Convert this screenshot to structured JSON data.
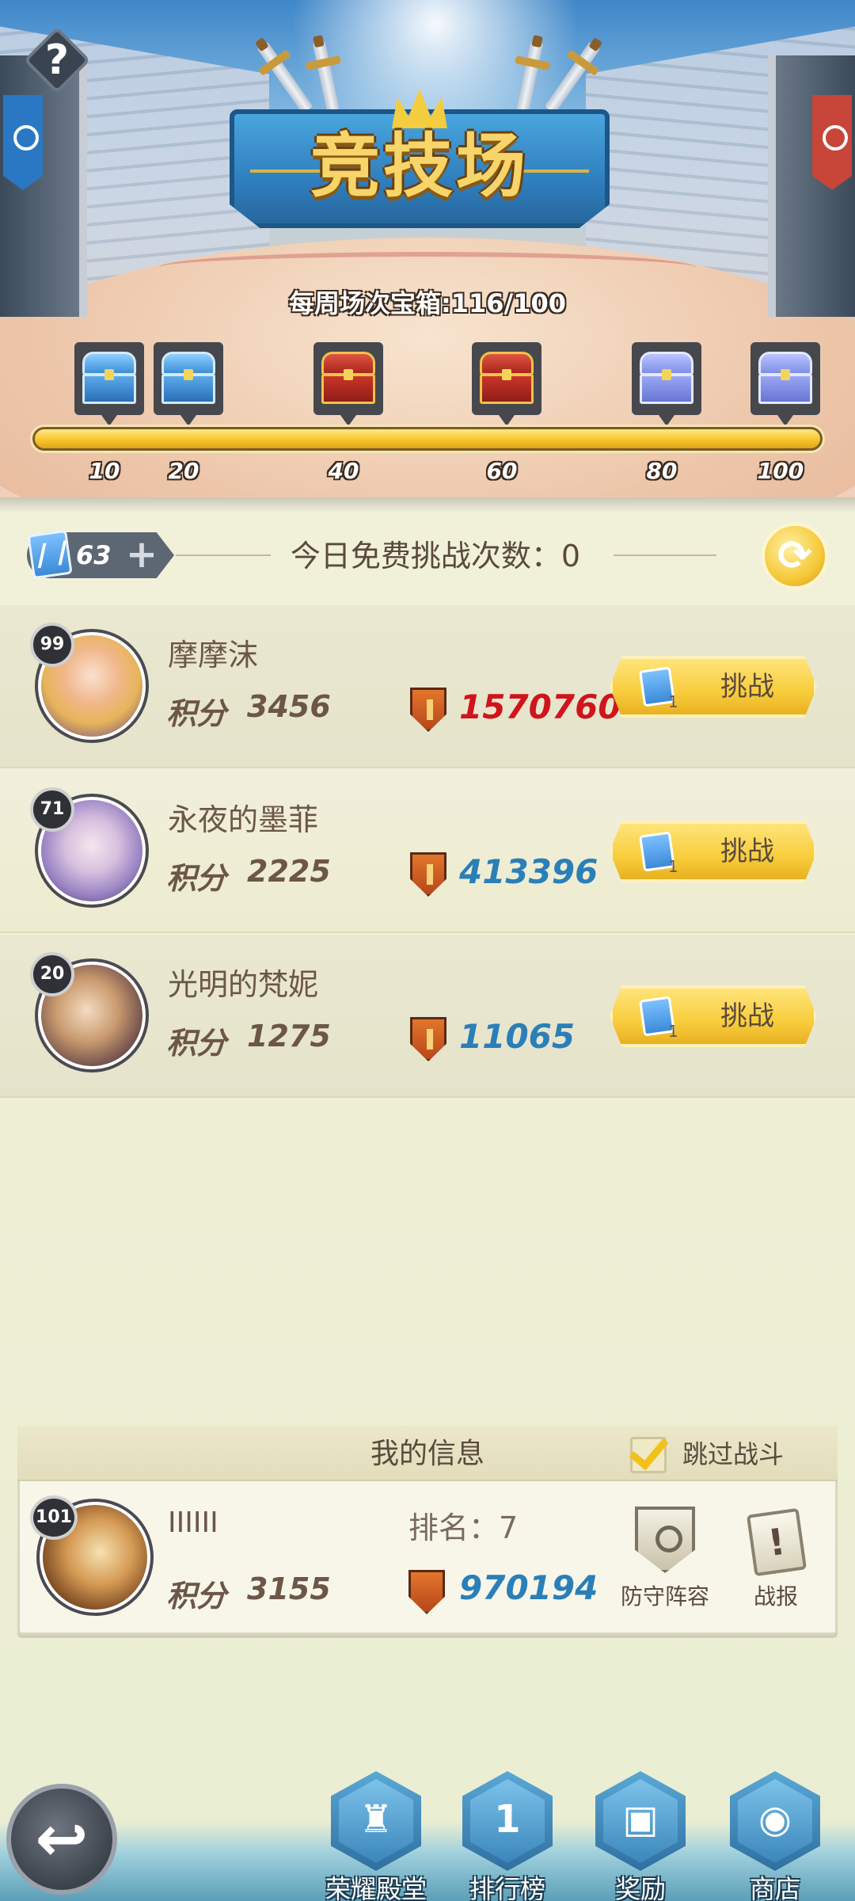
{
  "header": {
    "help_label": "?",
    "title": "竞技场",
    "weekly_chest_label": "每周场次宝箱:116/100",
    "weekly_progress_fraction": 1.0,
    "chests": [
      {
        "milestone": "10",
        "type": "blue"
      },
      {
        "milestone": "20",
        "type": "blue"
      },
      {
        "milestone": "40",
        "type": "red"
      },
      {
        "milestone": "60",
        "type": "red"
      },
      {
        "milestone": "80",
        "type": "purple"
      },
      {
        "milestone": "100",
        "type": "purple"
      }
    ]
  },
  "challenge_bar": {
    "ticket_count": "63",
    "plus_label": "+",
    "free_challenges_label": "今日免费挑战次数：0",
    "refresh_icon": "refresh-icon"
  },
  "opponents": [
    {
      "level": "99",
      "name": "摩摩沫",
      "score_label": "积分",
      "score": "3456",
      "power": "1570760",
      "power_color": "#d0141c",
      "ticket_cost": "1",
      "challenge_label": "挑战"
    },
    {
      "level": "71",
      "name": "永夜的墨菲",
      "score_label": "积分",
      "score": "2225",
      "power": "413396",
      "power_color": "#2a7fb8",
      "ticket_cost": "1",
      "challenge_label": "挑战"
    },
    {
      "level": "20",
      "name": "光明的梵妮",
      "score_label": "积分",
      "score": "1275",
      "power": "11065",
      "power_color": "#2a7fb8",
      "ticket_cost": "1",
      "challenge_label": "挑战"
    }
  ],
  "my_info": {
    "title": "我的信息",
    "skip_battle_label": "跳过战斗",
    "skip_battle_checked": true,
    "level": "101",
    "name": "IIIIII",
    "rank_label": "排名：7",
    "score_label": "积分",
    "score": "3155",
    "power": "970194",
    "defense_label": "防守阵容",
    "report_label": "战报",
    "report_glyph": "!"
  },
  "bottom_nav": {
    "back_glyph": "↩",
    "items": [
      {
        "label": "荣耀殿堂",
        "glyph": "♜"
      },
      {
        "label": "排行榜",
        "glyph": "1"
      },
      {
        "label": "奖励",
        "glyph": "▣"
      },
      {
        "label": "商店",
        "glyph": "◉"
      }
    ]
  },
  "colors": {
    "accent_gold": "#f8cd3c",
    "power_red": "#d0141c",
    "power_blue": "#2a7fb8",
    "text_brown": "#6b5648"
  }
}
